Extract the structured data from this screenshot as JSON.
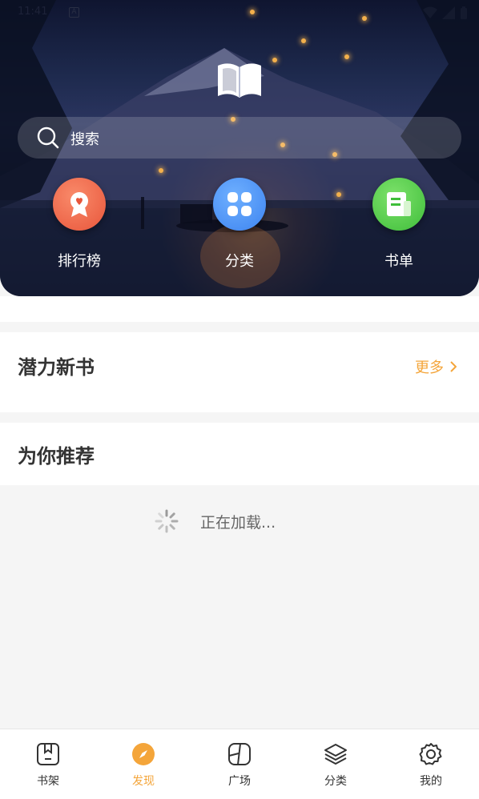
{
  "status_bar": {
    "time": "11:41",
    "notif_letter": "A"
  },
  "search": {
    "placeholder": "搜索"
  },
  "quick_entries": [
    {
      "label": "排行榜",
      "color": "#e8563b",
      "icon": "ranking-ribbon-icon"
    },
    {
      "label": "分类",
      "color": "#3d84f0",
      "icon": "category-grid-icon"
    },
    {
      "label": "书单",
      "color": "#3fbe3a",
      "icon": "booklist-icon"
    }
  ],
  "sections": {
    "new_books": {
      "title": "潜力新书",
      "more_label": "更多"
    },
    "recommend": {
      "title": "为你推荐"
    }
  },
  "loading": {
    "text": "正在加载..."
  },
  "bottom_nav": [
    {
      "label": "书架",
      "icon": "bookshelf-icon",
      "active": false
    },
    {
      "label": "发现",
      "icon": "compass-icon",
      "active": true
    },
    {
      "label": "广场",
      "icon": "square-icon",
      "active": false
    },
    {
      "label": "分类",
      "icon": "layers-icon",
      "active": false
    },
    {
      "label": "我的",
      "icon": "gear-icon",
      "active": false
    }
  ],
  "colors": {
    "accent": "#f4a53a",
    "text_primary": "#333333",
    "background": "#f5f5f5"
  }
}
